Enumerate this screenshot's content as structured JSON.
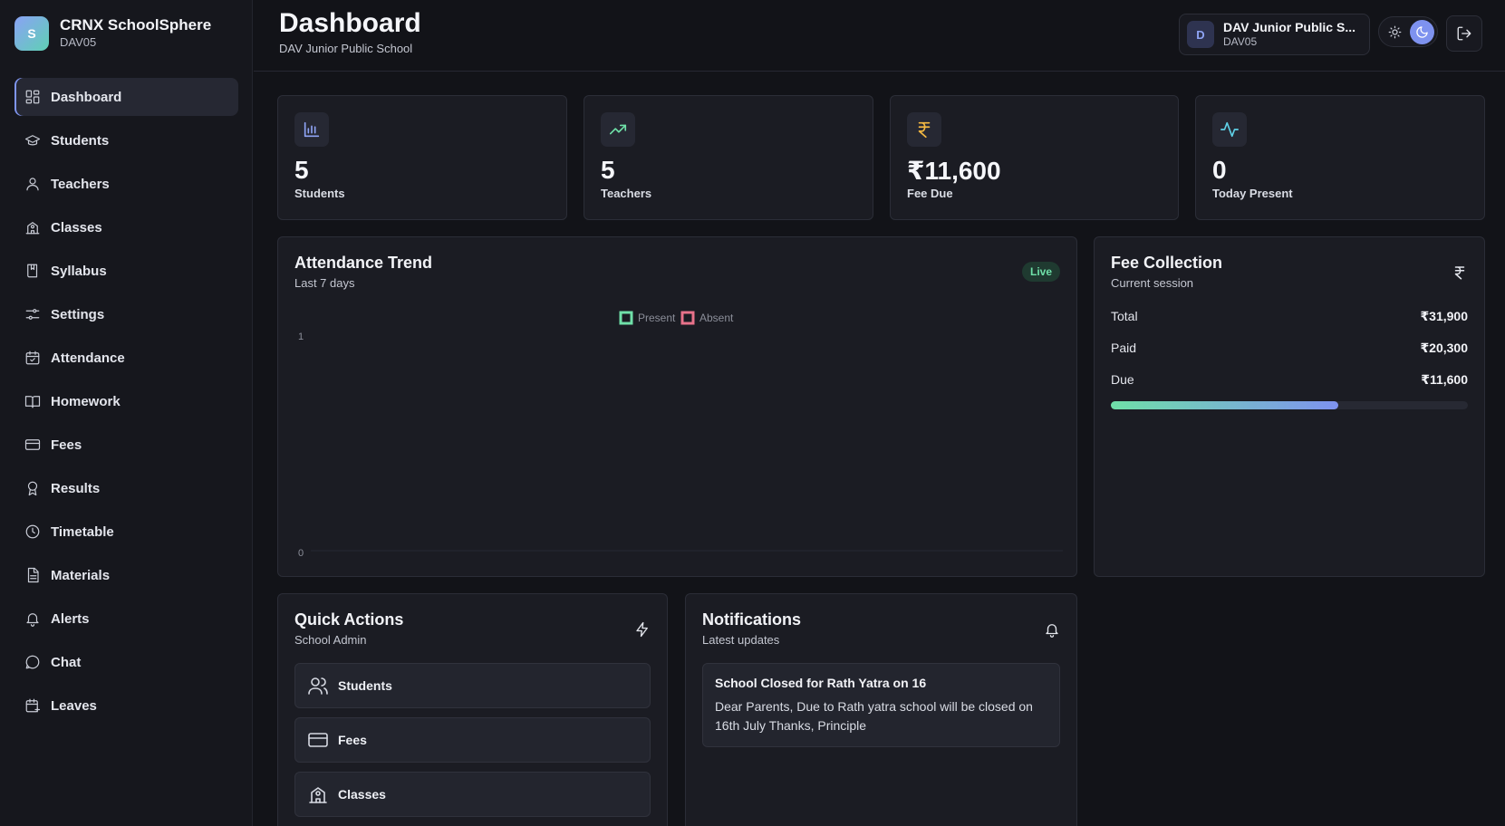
{
  "brand": {
    "logo_letter": "S",
    "name": "CRNX SchoolSphere",
    "code": "DAV05"
  },
  "sidebar": {
    "items": [
      {
        "label": "Dashboard",
        "icon": "dashboard-icon",
        "active": true
      },
      {
        "label": "Students",
        "icon": "graduation-cap-icon"
      },
      {
        "label": "Teachers",
        "icon": "user-icon"
      },
      {
        "label": "Classes",
        "icon": "school-building-icon"
      },
      {
        "label": "Syllabus",
        "icon": "book-bookmark-icon"
      },
      {
        "label": "Settings",
        "icon": "sliders-icon"
      },
      {
        "label": "Attendance",
        "icon": "calendar-check-icon"
      },
      {
        "label": "Homework",
        "icon": "open-book-icon"
      },
      {
        "label": "Fees",
        "icon": "credit-card-icon"
      },
      {
        "label": "Results",
        "icon": "award-icon"
      },
      {
        "label": "Timetable",
        "icon": "clock-icon"
      },
      {
        "label": "Materials",
        "icon": "document-icon"
      },
      {
        "label": "Alerts",
        "icon": "bell-icon"
      },
      {
        "label": "Chat",
        "icon": "chat-bubble-icon"
      },
      {
        "label": "Leaves",
        "icon": "calendar-plus-icon"
      }
    ]
  },
  "header": {
    "title": "Dashboard",
    "subtitle": "DAV Junior Public School",
    "school_chip": {
      "avatar_letter": "D",
      "name": "DAV Junior Public S...",
      "code": "DAV05"
    }
  },
  "stats": [
    {
      "value": "5",
      "label": "Students",
      "icon": "bar-chart-icon",
      "color": "#8fa4f5"
    },
    {
      "value": "5",
      "label": "Teachers",
      "icon": "trending-up-icon",
      "color": "#6fe0a8"
    },
    {
      "value": "₹11,600",
      "label": "Fee Due",
      "icon": "rupee-icon",
      "color": "#f5b942"
    },
    {
      "value": "0",
      "label": "Today Present",
      "icon": "activity-icon",
      "color": "#5fd0e6"
    }
  ],
  "attendance": {
    "title": "Attendance Trend",
    "subtitle": "Last 7 days",
    "badge": "Live"
  },
  "chart_data": {
    "type": "line",
    "series": [
      {
        "name": "Present",
        "values": [],
        "color": "#6fe0a8"
      },
      {
        "name": "Absent",
        "values": [],
        "color": "#e8728a"
      }
    ],
    "y_ticks": [
      "1",
      "0"
    ],
    "ylim": [
      0,
      1
    ],
    "legend": "top-center"
  },
  "fee_collection": {
    "title": "Fee Collection",
    "subtitle": "Current session",
    "rows": [
      {
        "label": "Total",
        "value": "₹31,900"
      },
      {
        "label": "Paid",
        "value": "₹20,300"
      },
      {
        "label": "Due",
        "value": "₹11,600"
      }
    ],
    "paid_fraction": 0.636
  },
  "quick_actions": {
    "title": "Quick Actions",
    "subtitle": "School Admin",
    "items": [
      {
        "label": "Students",
        "icon": "users-icon"
      },
      {
        "label": "Fees",
        "icon": "credit-card-icon"
      },
      {
        "label": "Classes",
        "icon": "school-building-icon"
      }
    ]
  },
  "notifications": {
    "title": "Notifications",
    "subtitle": "Latest updates",
    "items": [
      {
        "title": "School Closed for Rath Yatra on 16",
        "body": "Dear Parents, Due to Rath yatra school will be closed on 16th July Thanks, Principle"
      }
    ]
  }
}
